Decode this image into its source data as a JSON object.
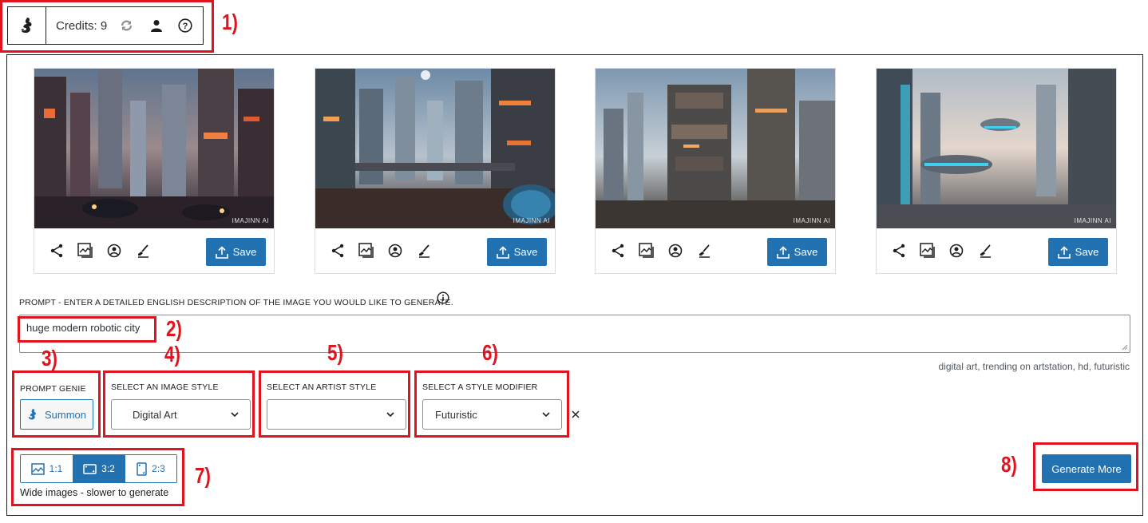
{
  "toolbar": {
    "credits_text": "Credits: 9",
    "icons": [
      "genie-logo-icon",
      "refresh-icon",
      "account-icon",
      "help-icon"
    ]
  },
  "images": [
    {
      "watermark": "IMAJINN AI",
      "actions": [
        "share-icon",
        "image-variations-icon",
        "face-icon",
        "edit-brush-icon"
      ],
      "save_label": "Save"
    },
    {
      "watermark": "IMAJINN AI",
      "actions": [
        "share-icon",
        "image-variations-icon",
        "face-icon",
        "edit-brush-icon"
      ],
      "save_label": "Save"
    },
    {
      "watermark": "IMAJINN AI",
      "actions": [
        "share-icon",
        "image-variations-icon",
        "face-icon",
        "edit-brush-icon"
      ],
      "save_label": "Save"
    },
    {
      "watermark": "IMAJINN AI",
      "actions": [
        "share-icon",
        "image-variations-icon",
        "face-icon",
        "edit-brush-icon"
      ],
      "save_label": "Save"
    }
  ],
  "prompt": {
    "label": "PROMPT - ENTER A DETAILED ENGLISH DESCRIPTION OF THE IMAGE YOU WOULD LIKE TO GENERATE.",
    "value": "huge modern robotic city",
    "suffix": "digital art, trending on artstation, hd, futuristic"
  },
  "prompt_genie": {
    "label": "PROMPT GENIE",
    "button": "Summon"
  },
  "image_style": {
    "label": "SELECT AN IMAGE STYLE",
    "value": "Digital Art"
  },
  "artist_style": {
    "label": "SELECT AN ARTIST STYLE",
    "value": ""
  },
  "style_modifier": {
    "label": "SELECT A STYLE MODIFIER",
    "value": "Futuristic"
  },
  "aspect_ratio": {
    "options": [
      {
        "label": "1:1",
        "icon": "square-image-icon",
        "active": false
      },
      {
        "label": "3:2",
        "icon": "wide-image-icon",
        "active": true
      },
      {
        "label": "2:3",
        "icon": "tall-image-icon",
        "active": false
      }
    ],
    "note": "Wide images - slower to generate"
  },
  "generate_button": "Generate More",
  "annotations": {
    "n1": "1)",
    "n2": "2)",
    "n3": "3)",
    "n4": "4)",
    "n5": "5)",
    "n6": "6)",
    "n7": "7)",
    "n8": "8)"
  },
  "colors": {
    "accent": "#2271b1",
    "annotation_red": "#e0141e",
    "border": "#1e1e1e"
  }
}
